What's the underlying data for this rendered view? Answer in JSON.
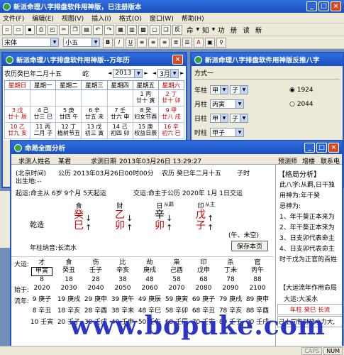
{
  "app": {
    "title": "新派命理八字排盘软件用神版，已注册版本"
  },
  "menu": [
    "文件(F)",
    "编辑(E)",
    "视图(V)",
    "插入(I)",
    "格式(O)",
    "窗口(W)",
    "帮助(H)"
  ],
  "toolbar": {
    "right_labels": [
      "命",
      "知",
      "功",
      "册",
      "读",
      "新"
    ],
    "font_name": "宋体",
    "font_size": "小五"
  },
  "calendar": {
    "title": "新派命理八字排盘软件用神版--万年历",
    "lunar_label": "农历癸巳年二月十五",
    "zodiac": "蛇",
    "year": "2013",
    "month": "3月",
    "weekdays": [
      "星期日",
      "星期一",
      "星期二",
      "星期三",
      "星期四",
      "星期五",
      "星期六"
    ],
    "rows": [
      [
        {
          "d": "",
          "s": ""
        },
        {
          "d": "",
          "s": ""
        },
        {
          "d": "",
          "s": ""
        },
        {
          "d": "",
          "s": ""
        },
        {
          "d": "",
          "s": ""
        },
        {
          "d": "1 丙",
          "s": "廿十 寅"
        },
        {
          "d": "2 丁",
          "s": "廿十 卯"
        }
      ],
      [
        {
          "d": "3 戊",
          "s": "廿十 辰"
        },
        {
          "d": "4 己",
          "s": "廿三 巳"
        },
        {
          "d": "5 庚",
          "s": "廿四 午"
        },
        {
          "d": "6 辛",
          "s": "廿五 未"
        },
        {
          "d": "7 壬",
          "s": "廿六 申"
        },
        {
          "d": "8 癸",
          "s": "妇女节酉"
        },
        {
          "d": "9 甲",
          "s": "廿八 戌"
        }
      ],
      [
        {
          "d": "10 乙",
          "s": "廿九 亥"
        },
        {
          "d": "11 丙",
          "s": "二月 子"
        },
        {
          "d": "12 丁",
          "s": "植树节丑"
        },
        {
          "d": "13 戊",
          "s": "初三 寅"
        },
        {
          "d": "14 己",
          "s": "初四 卯"
        },
        {
          "d": "15 庚",
          "s": "权益日辰"
        },
        {
          "d": "16 辛",
          "s": "初六 巳"
        }
      ]
    ]
  },
  "fan": {
    "title": "新派命理八字排盘软件用神版反推八字",
    "section": "方式一",
    "rows": [
      {
        "label": "年柱",
        "gan": "甲",
        "zhi": "子"
      },
      {
        "label": "月柱",
        "gan": "丙寅",
        "zhi": ""
      },
      {
        "label": "日柱",
        "gan": "甲",
        "zhi": "子"
      },
      {
        "label": "时柱",
        "gan": "甲子",
        "zhi": ""
      }
    ],
    "years": [
      "1924",
      "2044"
    ]
  },
  "full": {
    "title": "命局全面分析",
    "name_label": "求测人姓名",
    "name": "某君",
    "date_label": "求测日期",
    "date": "2013年03月26日 13:29:27",
    "right_tabs": [
      "预测师",
      "增楼",
      "联系电"
    ],
    "beijing_time": "(北京时间)",
    "gongli": "公历 2013年03月26日00时00分",
    "nongli": "农历 癸巳年二月十五",
    "shi": "子时",
    "birthplace": "出生地:--",
    "qiyun": "起运:命主从 6岁 9个月 5天起运",
    "jiaoyun": "交运:命主于公历 2020年 1月 1日交运",
    "shishen": [
      "食",
      "财",
      "日",
      "印"
    ],
    "shishen_sub": [
      "",
      "",
      "从羁",
      "从主"
    ],
    "qianzao": "乾造",
    "pillars": [
      {
        "gan": "癸",
        "zhi": "巳"
      },
      {
        "gan": "乙",
        "zhi": "卯"
      },
      {
        "gan": "辛",
        "zhi": "卯"
      },
      {
        "gan": "戊",
        "zhi": "子"
      }
    ],
    "wukong": "(午、未空)",
    "save": "保存本页",
    "nayin": "年柱纳音:长流水",
    "dayun_label": "大运:",
    "dayun_shishen": [
      "才",
      "食",
      "伤",
      "比",
      "劫",
      "枭",
      "印",
      "杀",
      "官"
    ],
    "dayun_gz": [
      "甲寅",
      "癸丑",
      "壬子",
      "辛亥",
      "庚戌",
      "己酉",
      "戊申",
      "丁未",
      "丙午"
    ],
    "dayun_age": [
      "8",
      "18",
      "28",
      "38",
      "48",
      "58",
      "68",
      "78",
      "88"
    ],
    "shiyu_label": "始于:",
    "dayun_year": [
      "2020",
      "2030",
      "2040",
      "2050",
      "2060",
      "2070",
      "2080",
      "2090",
      "2100"
    ],
    "liunian_label": "流年:",
    "liunian": [
      [
        "9 庚子",
        "19 庚戌",
        "29 庚申",
        "39 庚午",
        "49 庚辰",
        "59 庚寅",
        "69 庚子",
        "79 庚戌",
        "89 庚申"
      ],
      [
        "8 辛丑",
        "18 辛亥",
        "28 辛酉",
        "38 辛未",
        "48 辛巳",
        "58 辛卯",
        "68 辛丑",
        "78 辛亥",
        "88 辛酉"
      ],
      [
        "10 壬寅",
        "20 壬子",
        "30 壬戌",
        "40 壬申",
        "50 壬午",
        "60 壬辰",
        "70 壬寅",
        "80 壬子",
        "90 壬戌"
      ]
    ],
    "geju_title": "【格局分析】",
    "geju": [
      "此八字:从羁,日干独",
      "用神为:年干癸",
      "忌神为:",
      "1、年干葵正本来为",
      "2、年干葵正本来为",
      "3、日支卯代表命主",
      "4、日支卯代表命主",
      "时干戊为正官的百姓"
    ],
    "dayun_analysis_title": "【大运流年作用命局",
    "dayun_liu": "大运:大溪水",
    "dayun_row": "年柱 癸巳 长流",
    "dayun_row2": "己土同性财癸水力大,"
  },
  "watermark": "www.bopuke.com",
  "status": [
    "CAPS",
    "NUM"
  ]
}
